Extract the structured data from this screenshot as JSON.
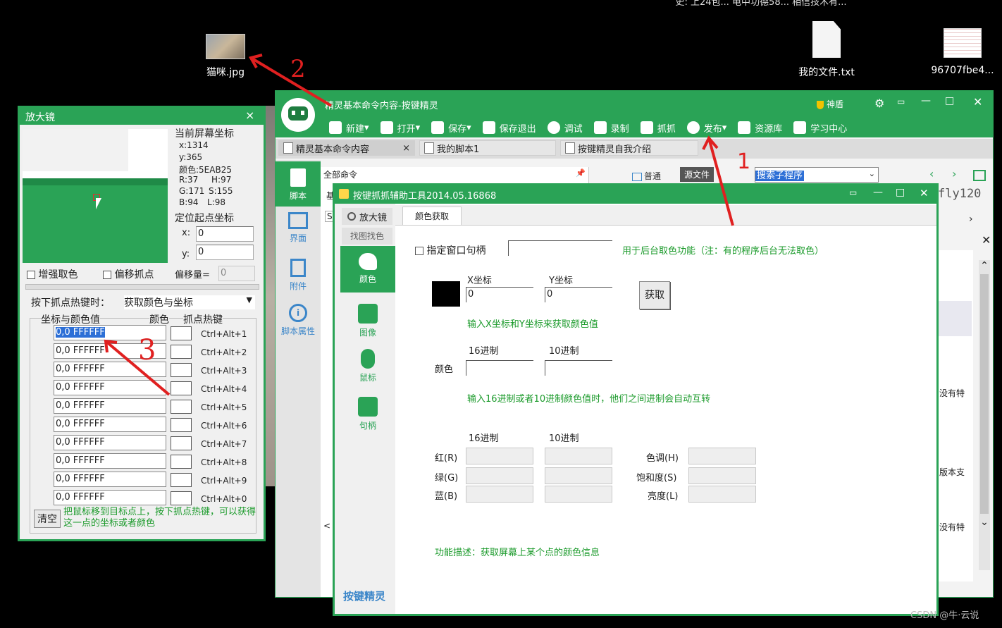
{
  "desktop": {
    "top_text": "史: 上24包... 电中功德58... 相信技术有...",
    "icons": [
      {
        "label": "猫咪.jpg"
      },
      {
        "label": "我的文件.txt"
      },
      {
        "label": "96707fbe4..."
      }
    ],
    "watermark": "CSDN @牛·云说",
    "annotations": [
      "2",
      "1",
      "3"
    ]
  },
  "main_window": {
    "title": "精灵基本命令内容-按键精灵",
    "shield_label": "神盾",
    "toolbar": [
      "新建",
      "打开",
      "保存",
      "保存退出",
      "调试",
      "录制",
      "抓抓",
      "发布",
      "资源库",
      "学习中心"
    ],
    "tabs": [
      "精灵基本命令内容",
      "我的脚本1",
      "按键精灵自我介绍"
    ],
    "tab_close": "×",
    "left_nav": [
      "脚本",
      "界面",
      "附件",
      "脚本属性"
    ],
    "all_commands": "全部命令",
    "mode_normal": "普通",
    "mode_source": "源文件",
    "search_placeholder": "搜索子程序",
    "right_fragment": "fly120",
    "right_snips": [
      "没有特",
      "版本支",
      "没有特"
    ],
    "partial_letters": [
      "基",
      "S"
    ]
  },
  "magnifier": {
    "title": "放大镜",
    "close": "×",
    "coords_label": "当前屏幕坐标",
    "x": "x:1314",
    "y": "y:365",
    "color": "颜色:5EAB25",
    "r": "R:37",
    "h": "H:97",
    "g": "G:171",
    "s": "S:155",
    "b": "B:94",
    "l": "L:98",
    "origin_label": "定位起点坐标",
    "origin_x_label": "x:",
    "origin_x_value": "0",
    "origin_y_label": "y:",
    "origin_y_value": "0",
    "enhance_label": "增强取色",
    "offset_point_label": "偏移抓点",
    "offset_amount_label": "偏移量=",
    "offset_amount_value": "0",
    "hotkey_label": "按下抓点热键时：",
    "hotkey_select": "获取颜色与坐标",
    "col_coord_color": "坐标与颜色值",
    "col_color": "颜色",
    "col_hotkey": "抓点热键",
    "rows": [
      {
        "value": "0,0  FFFFFF",
        "key": "Ctrl+Alt+1"
      },
      {
        "value": "0,0  FFFFFF",
        "key": "Ctrl+Alt+2"
      },
      {
        "value": "0,0  FFFFFF",
        "key": "Ctrl+Alt+3"
      },
      {
        "value": "0,0  FFFFFF",
        "key": "Ctrl+Alt+4"
      },
      {
        "value": "0,0  FFFFFF",
        "key": "Ctrl+Alt+5"
      },
      {
        "value": "0,0  FFFFFF",
        "key": "Ctrl+Alt+6"
      },
      {
        "value": "0,0  FFFFFF",
        "key": "Ctrl+Alt+7"
      },
      {
        "value": "0,0  FFFFFF",
        "key": "Ctrl+Alt+8"
      },
      {
        "value": "0,0  FFFFFF",
        "key": "Ctrl+Alt+9"
      },
      {
        "value": "0,0  FFFFFF",
        "key": "Ctrl+Alt+0"
      }
    ],
    "clear_label": "清空",
    "hint": "把鼠标移到目标点上，按下抓点热键，可以获得这一点的坐标或者颜色"
  },
  "tool_window": {
    "title": "按键抓抓辅助工具2014.05.16868",
    "side_tabs": [
      "放大镜",
      "找图找色"
    ],
    "side_items": [
      "颜色",
      "图像",
      "鼠标",
      "句柄"
    ],
    "brand": "按键精灵",
    "active_tab": "颜色获取",
    "specify_handle_label": "指定窗口句柄",
    "handle_value": "",
    "handle_hint": "用于后台取色功能（注：有的程序后台无法取色）",
    "x_label": "X坐标",
    "y_label": "Y坐标",
    "x_value": "0",
    "y_value": "0",
    "get_button": "获取",
    "hint_xy": "输入X坐标和Y坐标来获取颜色值",
    "hex_label": "16进制",
    "dec_label": "10进制",
    "color_label": "颜色",
    "hint_convert": "输入16进制或者10进制颜色值时，他们之间进制会自动互转",
    "hex_label2": "16进制",
    "dec_label2": "10进制",
    "red_label": "红(R)",
    "green_label": "绿(G)",
    "blue_label": "蓝(B)",
    "hue_label": "色调(H)",
    "sat_label": "饱和度(S)",
    "lum_label": "亮度(L)",
    "description": "功能描述：获取屏幕上某个点的颜色信息"
  }
}
